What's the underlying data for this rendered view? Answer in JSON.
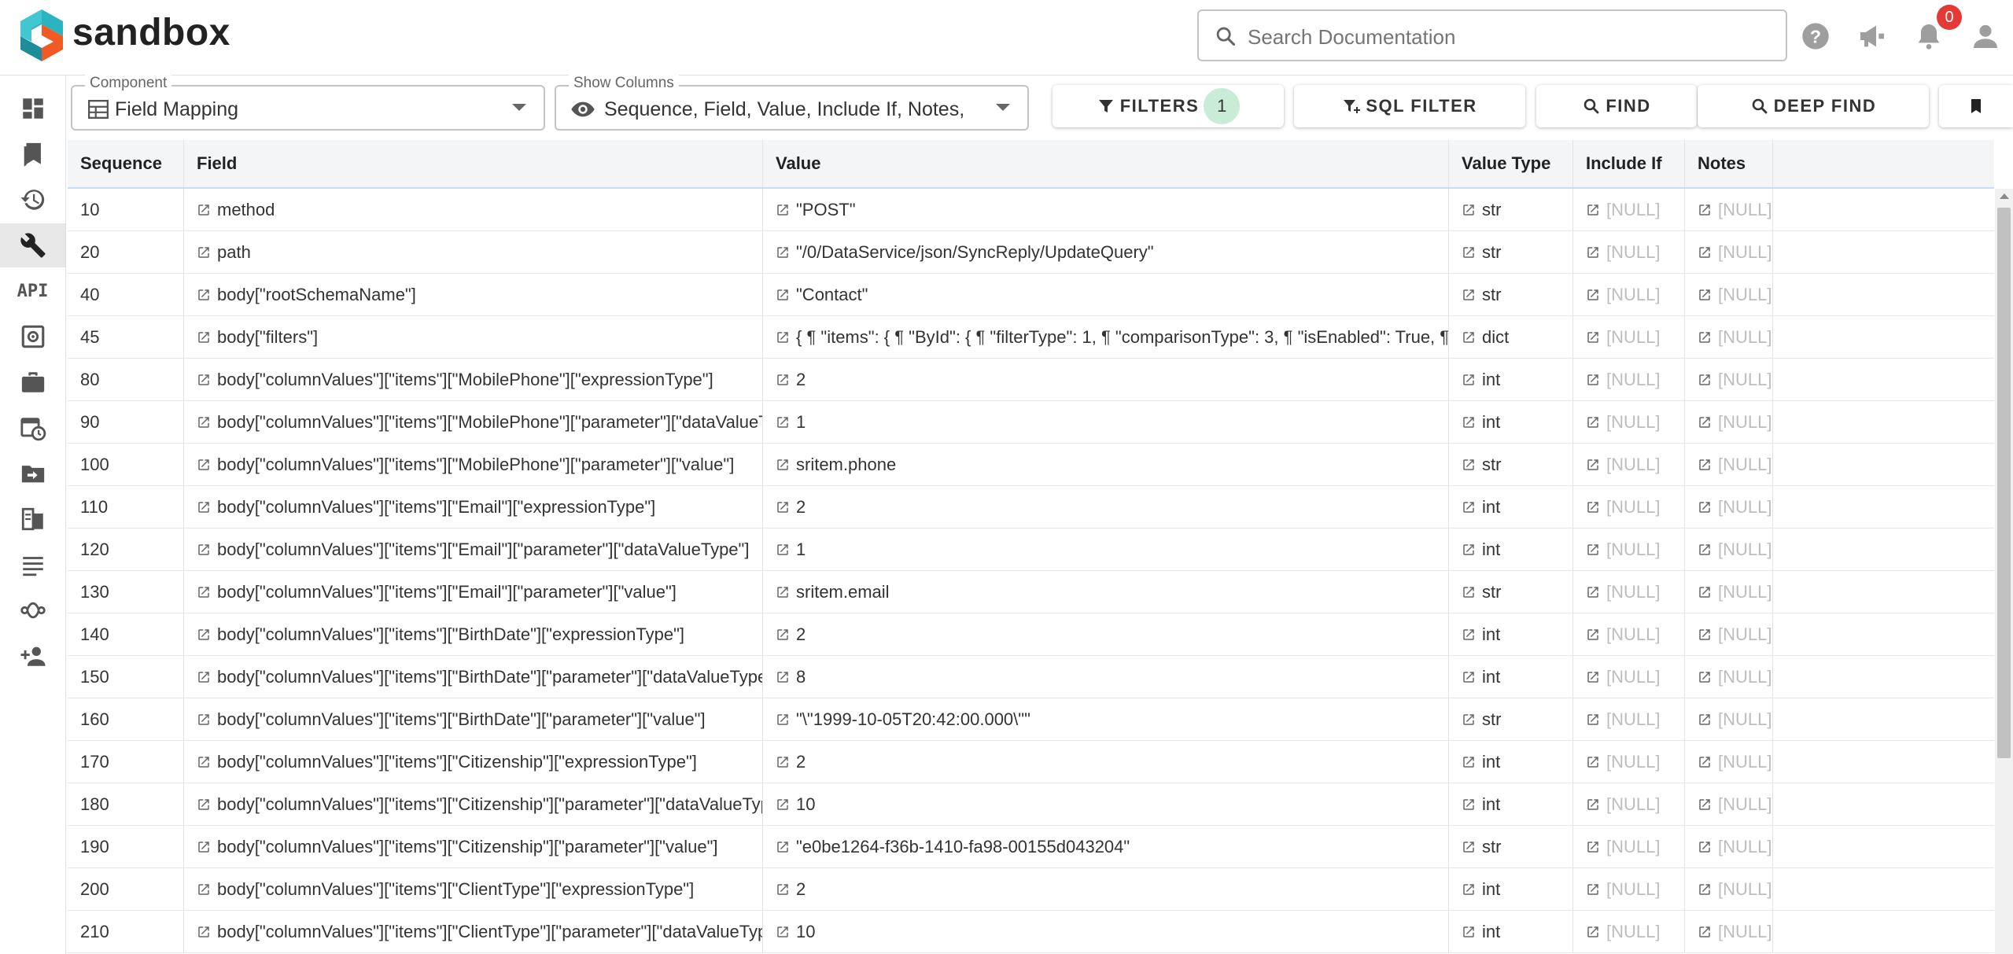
{
  "app": {
    "brand": "sandbox"
  },
  "search": {
    "placeholder": "Search Documentation"
  },
  "header": {
    "notification_count": "0"
  },
  "rail": {
    "items": [
      {
        "name": "dashboard"
      },
      {
        "name": "bookmarks"
      },
      {
        "name": "history"
      },
      {
        "name": "tools",
        "active": true
      },
      {
        "name": "api",
        "label": "API"
      },
      {
        "name": "safe"
      },
      {
        "name": "briefcase"
      },
      {
        "name": "schedule"
      },
      {
        "name": "folder-move"
      },
      {
        "name": "documents"
      },
      {
        "name": "list"
      },
      {
        "name": "workflow"
      },
      {
        "name": "add-user"
      }
    ]
  },
  "toolbar": {
    "component": {
      "legend": "Component",
      "value": "Field Mapping"
    },
    "columns": {
      "legend": "Show Columns",
      "value": "Sequence, Field, Value, Include If, Notes,"
    },
    "filters_label": "FILTERS",
    "filters_count": "1",
    "sql_filter_label": "SQL FILTER",
    "find_label": "FIND",
    "deep_find_label": "DEEP FIND"
  },
  "table": {
    "headers": [
      "Sequence",
      "Field",
      "Value",
      "Value Type",
      "Include If",
      "Notes"
    ],
    "rows": [
      [
        "10",
        "method",
        "\"POST\"",
        "str",
        "[NULL]",
        "[NULL]"
      ],
      [
        "20",
        "path",
        "\"/0/DataService/json/SyncReply/UpdateQuery\"",
        "str",
        "[NULL]",
        "[NULL]"
      ],
      [
        "40",
        "body[\"rootSchemaName\"]",
        "\"Contact\"",
        "str",
        "[NULL]",
        "[NULL]"
      ],
      [
        "45",
        "body[\"filters\"]",
        "{ ¶ \"items\": { ¶ \"ById\": { ¶ \"filterType\": 1, ¶ \"comparisonType\": 3, ¶ \"isEnabled\": True, ¶ \"trim",
        "dict",
        "[NULL]",
        "[NULL]"
      ],
      [
        "80",
        "body[\"columnValues\"][\"items\"][\"MobilePhone\"][\"expressionType\"]",
        "2",
        "int",
        "[NULL]",
        "[NULL]"
      ],
      [
        "90",
        "body[\"columnValues\"][\"items\"][\"MobilePhone\"][\"parameter\"][\"dataValueType\"]",
        "1",
        "int",
        "[NULL]",
        "[NULL]"
      ],
      [
        "100",
        "body[\"columnValues\"][\"items\"][\"MobilePhone\"][\"parameter\"][\"value\"]",
        "sritem.phone",
        "str",
        "[NULL]",
        "[NULL]"
      ],
      [
        "110",
        "body[\"columnValues\"][\"items\"][\"Email\"][\"expressionType\"]",
        "2",
        "int",
        "[NULL]",
        "[NULL]"
      ],
      [
        "120",
        "body[\"columnValues\"][\"items\"][\"Email\"][\"parameter\"][\"dataValueType\"]",
        "1",
        "int",
        "[NULL]",
        "[NULL]"
      ],
      [
        "130",
        "body[\"columnValues\"][\"items\"][\"Email\"][\"parameter\"][\"value\"]",
        "sritem.email",
        "str",
        "[NULL]",
        "[NULL]"
      ],
      [
        "140",
        "body[\"columnValues\"][\"items\"][\"BirthDate\"][\"expressionType\"]",
        "2",
        "int",
        "[NULL]",
        "[NULL]"
      ],
      [
        "150",
        "body[\"columnValues\"][\"items\"][\"BirthDate\"][\"parameter\"][\"dataValueType\"]",
        "8",
        "int",
        "[NULL]",
        "[NULL]"
      ],
      [
        "160",
        "body[\"columnValues\"][\"items\"][\"BirthDate\"][\"parameter\"][\"value\"]",
        "\"\\\"1999-10-05T20:42:00.000\\\"\"",
        "str",
        "[NULL]",
        "[NULL]"
      ],
      [
        "170",
        "body[\"columnValues\"][\"items\"][\"Citizenship\"][\"expressionType\"]",
        "2",
        "int",
        "[NULL]",
        "[NULL]"
      ],
      [
        "180",
        "body[\"columnValues\"][\"items\"][\"Citizenship\"][\"parameter\"][\"dataValueType\"]",
        "10",
        "int",
        "[NULL]",
        "[NULL]"
      ],
      [
        "190",
        "body[\"columnValues\"][\"items\"][\"Citizenship\"][\"parameter\"][\"value\"]",
        "\"e0be1264-f36b-1410-fa98-00155d043204\"",
        "str",
        "[NULL]",
        "[NULL]"
      ],
      [
        "200",
        "body[\"columnValues\"][\"items\"][\"ClientType\"][\"expressionType\"]",
        "2",
        "int",
        "[NULL]",
        "[NULL]"
      ],
      [
        "210",
        "body[\"columnValues\"][\"items\"][\"ClientType\"][\"parameter\"][\"dataValueType\"]",
        "10",
        "int",
        "[NULL]",
        "[NULL]"
      ]
    ]
  }
}
